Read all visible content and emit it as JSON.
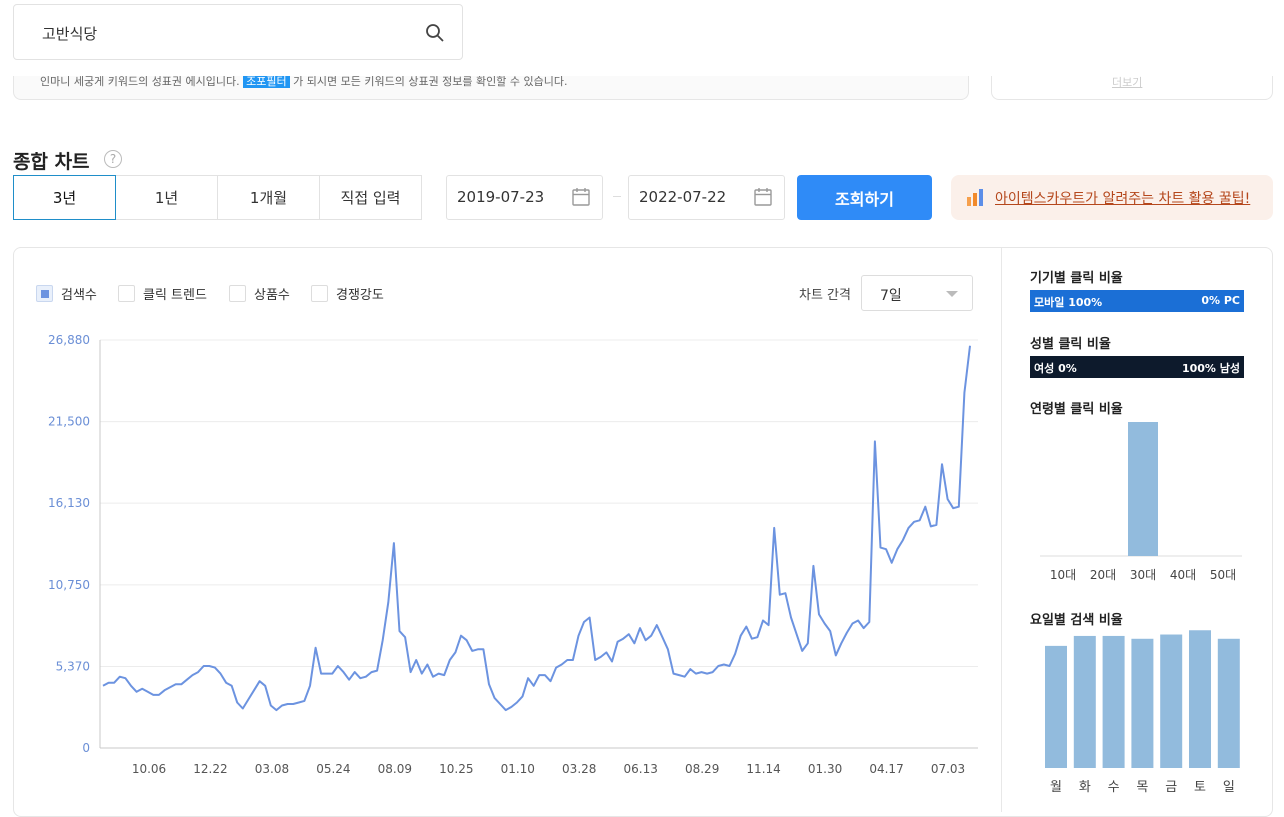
{
  "search": {
    "query": "고반식당"
  },
  "notice": {
    "text_before": "인마니 세궁게 키워드의 성표권 에시입니다.",
    "highlight": "조포필터",
    "text_after": "가 되시면 모든 키워드의 상표권 정보를 확인할 수 있습니다.",
    "side_link": "더보기"
  },
  "section": {
    "title": "종합 차트",
    "help_icon": "question-mark-icon"
  },
  "period_tabs": [
    {
      "label": "3년",
      "active": true
    },
    {
      "label": "1년",
      "active": false
    },
    {
      "label": "1개월",
      "active": false
    },
    {
      "label": "직접 입력",
      "active": false
    }
  ],
  "date_range": {
    "start": "2019-07-23",
    "end": "2022-07-22"
  },
  "query_button": "조회하기",
  "tip_banner": {
    "icon": "bar-chart-icon",
    "text": "아이템스카우트가 알려주는 차트 활용 꿀팁!"
  },
  "legend": [
    {
      "label": "검색수",
      "checked": true
    },
    {
      "label": "클릭 트렌드",
      "checked": false
    },
    {
      "label": "상품수",
      "checked": false
    },
    {
      "label": "경쟁강도",
      "checked": false
    }
  ],
  "interval": {
    "label": "차트 간격",
    "value": "7일"
  },
  "colors": {
    "accent": "#2f8bf7",
    "line": "#6c93e0",
    "bar": "#92bbdd",
    "device_bar": "#1b6fd6",
    "gender_bar": "#0d1a2c",
    "tip_text": "#b5471c"
  },
  "chart_data": [
    {
      "type": "line",
      "title": "",
      "xlabel": "",
      "ylabel": "",
      "yticks": [
        "0",
        "5,370",
        "10,750",
        "16,130",
        "21,500",
        "26,880"
      ],
      "ylim": [
        0,
        26880
      ],
      "xtick_labels": [
        "10.06",
        "12.22",
        "03.08",
        "05.24",
        "08.09",
        "10.25",
        "01.10",
        "03.28",
        "06.13",
        "08.29",
        "11.14",
        "01.30",
        "04.17",
        "07.03"
      ],
      "grid": true,
      "series": [
        {
          "name": "검색수",
          "values": [
            4100,
            4300,
            4300,
            4700,
            4600,
            4100,
            3700,
            3900,
            3700,
            3500,
            3500,
            3800,
            4000,
            4200,
            4200,
            4500,
            4800,
            5000,
            5400,
            5400,
            5300,
            4900,
            4300,
            4100,
            3000,
            2600,
            3200,
            3800,
            4400,
            4100,
            2800,
            2500,
            2800,
            2900,
            2900,
            3000,
            3100,
            4100,
            6600,
            4900,
            4900,
            4900,
            5400,
            5000,
            4500,
            5000,
            4600,
            4700,
            5000,
            5100,
            7100,
            9600,
            13500,
            7700,
            7300,
            5000,
            5800,
            4900,
            5500,
            4700,
            4900,
            4800,
            5800,
            6300,
            7400,
            7100,
            6400,
            6500,
            6500,
            4200,
            3300,
            2900,
            2500,
            2700,
            3000,
            3400,
            4600,
            4100,
            4800,
            4800,
            4400,
            5300,
            5500,
            5800,
            5800,
            7400,
            8300,
            8600,
            5800,
            6000,
            6300,
            5700,
            7000,
            7200,
            7500,
            6900,
            7900,
            7100,
            7400,
            8100,
            7300,
            6500,
            4900,
            4800,
            4700,
            5200,
            4900,
            5000,
            4900,
            5000,
            5400,
            5500,
            5400,
            6200,
            7400,
            8000,
            7200,
            7300,
            8400,
            8100,
            14500,
            10100,
            10200,
            8600,
            7500,
            6400,
            6900,
            12000,
            8800,
            8200,
            7700,
            6100,
            6900,
            7600,
            8200,
            8400,
            7900,
            8300,
            20200,
            13200,
            13100,
            12200,
            13100,
            13700,
            14500,
            14900,
            15000,
            15900,
            14600,
            14700,
            18700,
            16400,
            15800,
            15900,
            23400,
            26500
          ]
        }
      ]
    },
    {
      "type": "bar",
      "title": "연령별 클릭 비율",
      "categories": [
        "10대",
        "20대",
        "30대",
        "40대",
        "50대"
      ],
      "values": [
        0,
        0,
        100,
        0,
        0
      ]
    },
    {
      "type": "bar",
      "title": "요일별 검색 비율",
      "categories": [
        "월",
        "화",
        "수",
        "목",
        "금",
        "토",
        "일"
      ],
      "values": [
        86,
        93,
        93,
        91,
        94,
        97,
        91
      ],
      "ylim": [
        0,
        100
      ]
    }
  ],
  "sidebar": {
    "device": {
      "title": "기기별 클릭 비율",
      "left": "모바일 100%",
      "right": "0% PC"
    },
    "gender": {
      "title": "성별 클릭 비율",
      "left": "여성 0%",
      "right": "100% 남성"
    },
    "age": {
      "title": "연령별 클릭 비율"
    },
    "weekday": {
      "title": "요일별 검색 비율"
    }
  }
}
